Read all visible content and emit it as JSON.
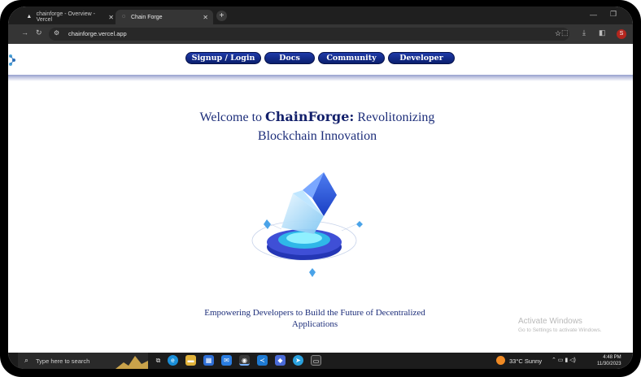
{
  "browser": {
    "tabs": [
      {
        "title": "chainforge - Overview - Vercel",
        "icon": "vercel-triangle-icon",
        "active": false
      },
      {
        "title": "Chain Forge",
        "icon": "globe-icon",
        "active": true
      }
    ],
    "new_tab_label": "+",
    "address": "chainforge.vercel.app",
    "profile_initial": "S"
  },
  "site": {
    "nav": [
      {
        "label": "Signup / Login"
      },
      {
        "label": "Docs"
      },
      {
        "label": "Community"
      },
      {
        "label": "Developer"
      }
    ],
    "hero": {
      "prefix": "Welcome to ",
      "brand": "ChainForge:",
      "suffix": " Revolitonizing Blockchain Innovation"
    },
    "tagline": "Empowering Developers to Build the Future of Decentralized Applications",
    "colors": {
      "nav_button": "#1a2f8f",
      "heading": "#1d2e7a"
    }
  },
  "watermark": {
    "title": "Activate Windows",
    "subtitle": "Go to Settings to activate Windows."
  },
  "taskbar": {
    "search_placeholder": "Type here to search",
    "weather": "33°C  Sunny",
    "time": "4:48 PM",
    "date": "11/30/2023"
  }
}
